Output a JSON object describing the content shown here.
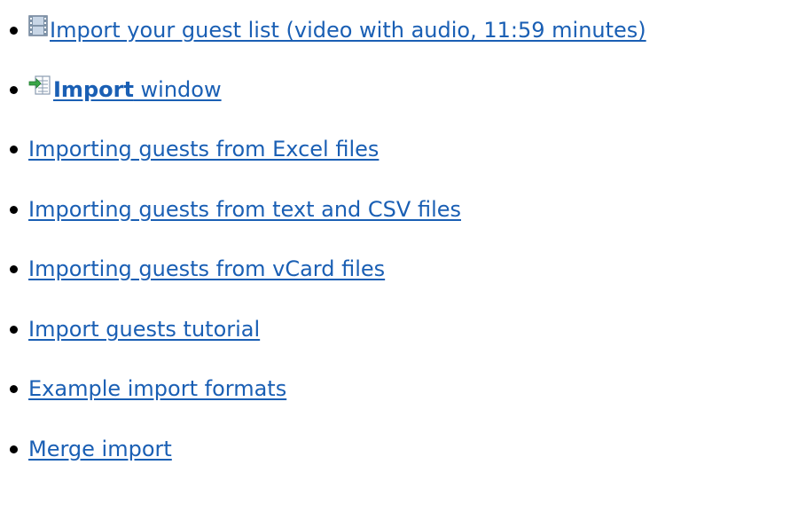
{
  "links": {
    "video": {
      "icon": "film-icon",
      "label": "Import your guest list (video with audio, 11:59 minutes)"
    },
    "import_window": {
      "icon": "import-icon",
      "bold_label": "Import",
      "suffix": " window"
    },
    "items": [
      {
        "label": "Importing guests from Excel files"
      },
      {
        "label": "Importing guests from text and CSV files"
      },
      {
        "label": "Importing guests from vCard files"
      },
      {
        "label": "Import guests tutorial"
      },
      {
        "label": "Example import formats"
      },
      {
        "label": "Merge import"
      }
    ]
  },
  "colors": {
    "link": "#1a5fb4",
    "bullet": "#000000"
  }
}
